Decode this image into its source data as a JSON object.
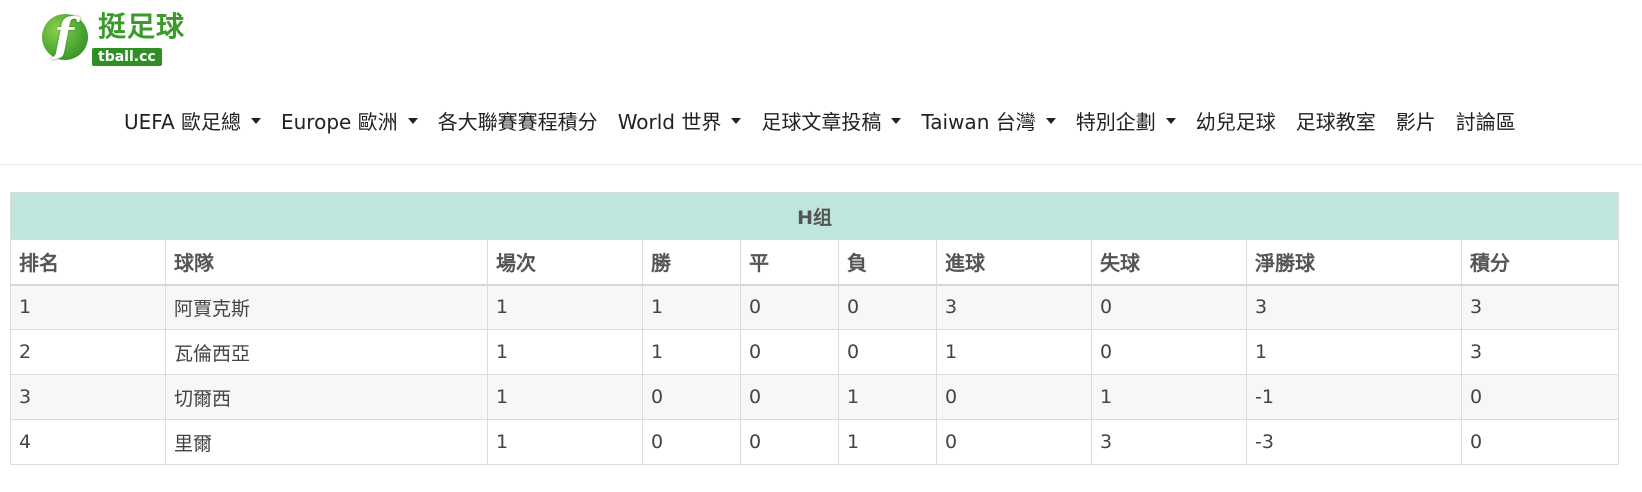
{
  "logo": {
    "cn": "挺足球",
    "en": "tball.cc"
  },
  "nav": {
    "items": [
      {
        "label": "UEFA 歐足總",
        "dropdown": true
      },
      {
        "label": "Europe 歐洲",
        "dropdown": true
      },
      {
        "label": "各大聯賽賽程積分",
        "dropdown": false
      },
      {
        "label": "World 世界",
        "dropdown": true
      },
      {
        "label": "足球文章投稿",
        "dropdown": true
      },
      {
        "label": "Taiwan 台灣",
        "dropdown": true
      },
      {
        "label": "特別企劃",
        "dropdown": true
      },
      {
        "label": "幼兒足球",
        "dropdown": false
      },
      {
        "label": "足球教室",
        "dropdown": false
      },
      {
        "label": "影片",
        "dropdown": false
      },
      {
        "label": "討論區",
        "dropdown": false
      }
    ]
  },
  "table": {
    "group_title": "H组",
    "columns": [
      "排名",
      "球隊",
      "場次",
      "勝",
      "平",
      "負",
      "進球",
      "失球",
      "淨勝球",
      "積分"
    ],
    "rows": [
      [
        "1",
        "阿賈克斯",
        "1",
        "1",
        "0",
        "0",
        "3",
        "0",
        "3",
        "3"
      ],
      [
        "2",
        "瓦倫西亞",
        "1",
        "1",
        "0",
        "0",
        "1",
        "0",
        "1",
        "3"
      ],
      [
        "3",
        "切爾西",
        "1",
        "0",
        "0",
        "1",
        "0",
        "1",
        "-1",
        "0"
      ],
      [
        "4",
        "里爾",
        "1",
        "0",
        "0",
        "1",
        "0",
        "3",
        "-3",
        "0"
      ]
    ]
  }
}
